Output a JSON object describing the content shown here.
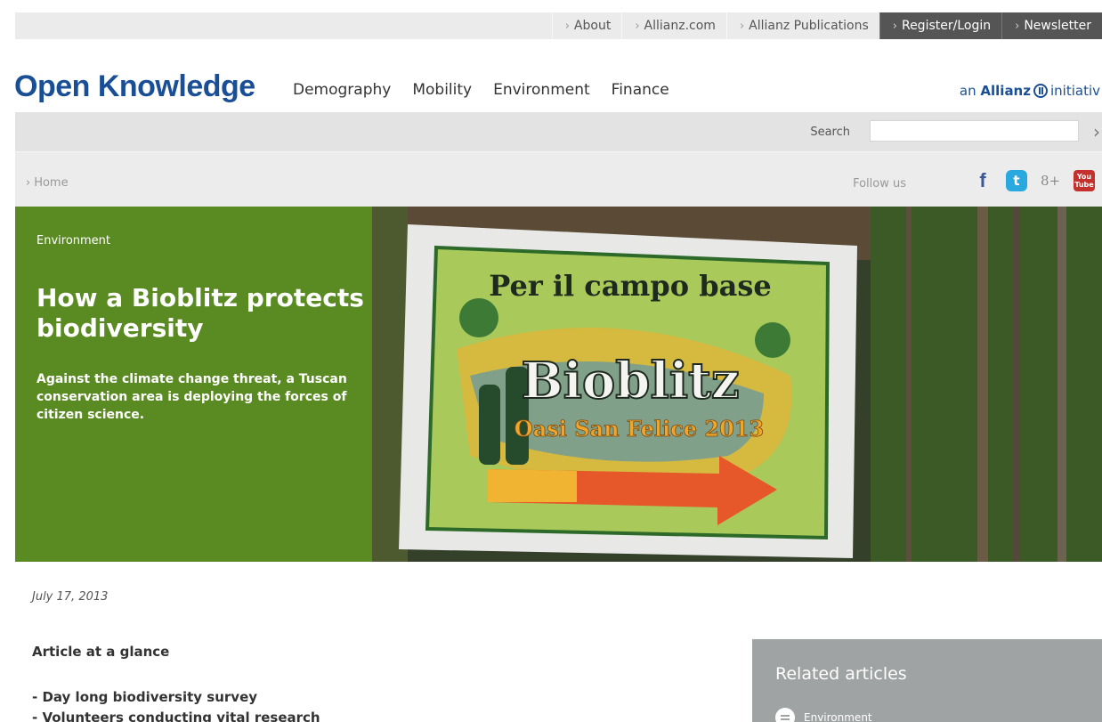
{
  "topnav": {
    "links": [
      {
        "label": "About"
      },
      {
        "label": "Allianz.com"
      },
      {
        "label": "Allianz Publications"
      },
      {
        "label": "Register/Login"
      },
      {
        "label": "Newsletter"
      }
    ]
  },
  "header": {
    "logo": "Open Knowledge",
    "nav": [
      "Demography",
      "Mobility",
      "Environment",
      "Finance"
    ],
    "tagline_prefix": "an",
    "tagline_brand": "Allianz",
    "tagline_suffix": "initiativ"
  },
  "search": {
    "label": "Search",
    "value": ""
  },
  "breadcrumb": {
    "home": "Home"
  },
  "social": {
    "label": "Follow us",
    "icons": [
      "facebook-icon",
      "twitter-icon",
      "googleplus-icon",
      "youtube-icon"
    ],
    "fb": "f",
    "tw": "t",
    "gp": "8+",
    "yt_top": "You",
    "yt_bottom": "Tube"
  },
  "hero": {
    "category": "Environment",
    "title": "How a Bioblitz protects biodiversity",
    "subtitle": "Against the climate change threat, a Tuscan conservation area is deploying the forces of citizen science.",
    "sign_title": "Per il campo base",
    "sign_brand": "Bioblitz",
    "sign_event": "Oasi San Felice 2013",
    "color": "#5a8a22"
  },
  "article": {
    "date": "July 17, 2013",
    "glance_heading": "Article at a glance",
    "glance_items": [
      "- Day long biodiversity survey",
      "- Volunteers conducting vital research"
    ]
  },
  "related": {
    "heading": "Related articles",
    "first_item": "Environment"
  }
}
